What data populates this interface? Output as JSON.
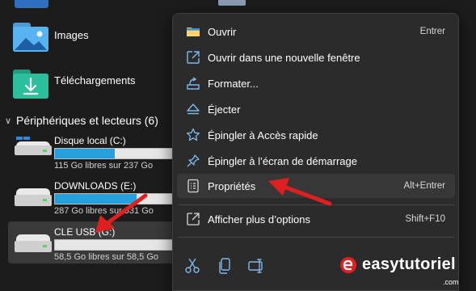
{
  "explorer": {
    "folders": [
      {
        "label": "Images",
        "icon": "images-folder-icon"
      },
      {
        "label": "Téléchargements",
        "icon": "downloads-folder-icon"
      }
    ],
    "section": {
      "title": "Périphériques et lecteurs (6)"
    },
    "drives": [
      {
        "name": "Disque local (C:)",
        "sub": "115 Go libres sur 237 Go",
        "used_fraction": 0.51
      },
      {
        "name": "DOWNLOADS (E:)",
        "sub": "287 Go libres sur 931 Go",
        "used_fraction": 0.69
      },
      {
        "name": "CLE USB (G:)",
        "sub": "58,5 Go libres sur 58,5 Go",
        "used_fraction": 0.0
      }
    ]
  },
  "menu": {
    "items": [
      {
        "label": "Ouvrir",
        "shortcut": "Entrer",
        "icon": "open-folder-icon"
      },
      {
        "label": "Ouvrir dans une nouvelle fenêtre",
        "shortcut": "",
        "icon": "new-window-icon"
      },
      {
        "label": "Formater...",
        "shortcut": "",
        "icon": "format-icon"
      },
      {
        "label": "Éjecter",
        "shortcut": "",
        "icon": "eject-icon"
      },
      {
        "label": "Épingler à Accès rapide",
        "shortcut": "",
        "icon": "star-icon"
      },
      {
        "label": "Épingler à l’écran de démarrage",
        "shortcut": "",
        "icon": "pin-icon"
      },
      {
        "label": "Propriétés",
        "shortcut": "Alt+Entrer",
        "icon": "properties-icon"
      },
      {
        "label": "Afficher plus d’options",
        "shortcut": "Shift+F10",
        "icon": "more-options-icon"
      }
    ],
    "bottom_icons": [
      "cut-icon",
      "copy-icon",
      "rename-icon"
    ]
  },
  "watermark": {
    "text": "easytutoriel",
    "suffix": ".com"
  },
  "colors": {
    "accent_red": "#e02020",
    "selection": "#373737",
    "menu_bg": "#2b2b2b",
    "bar_fill": "#26a0da"
  }
}
